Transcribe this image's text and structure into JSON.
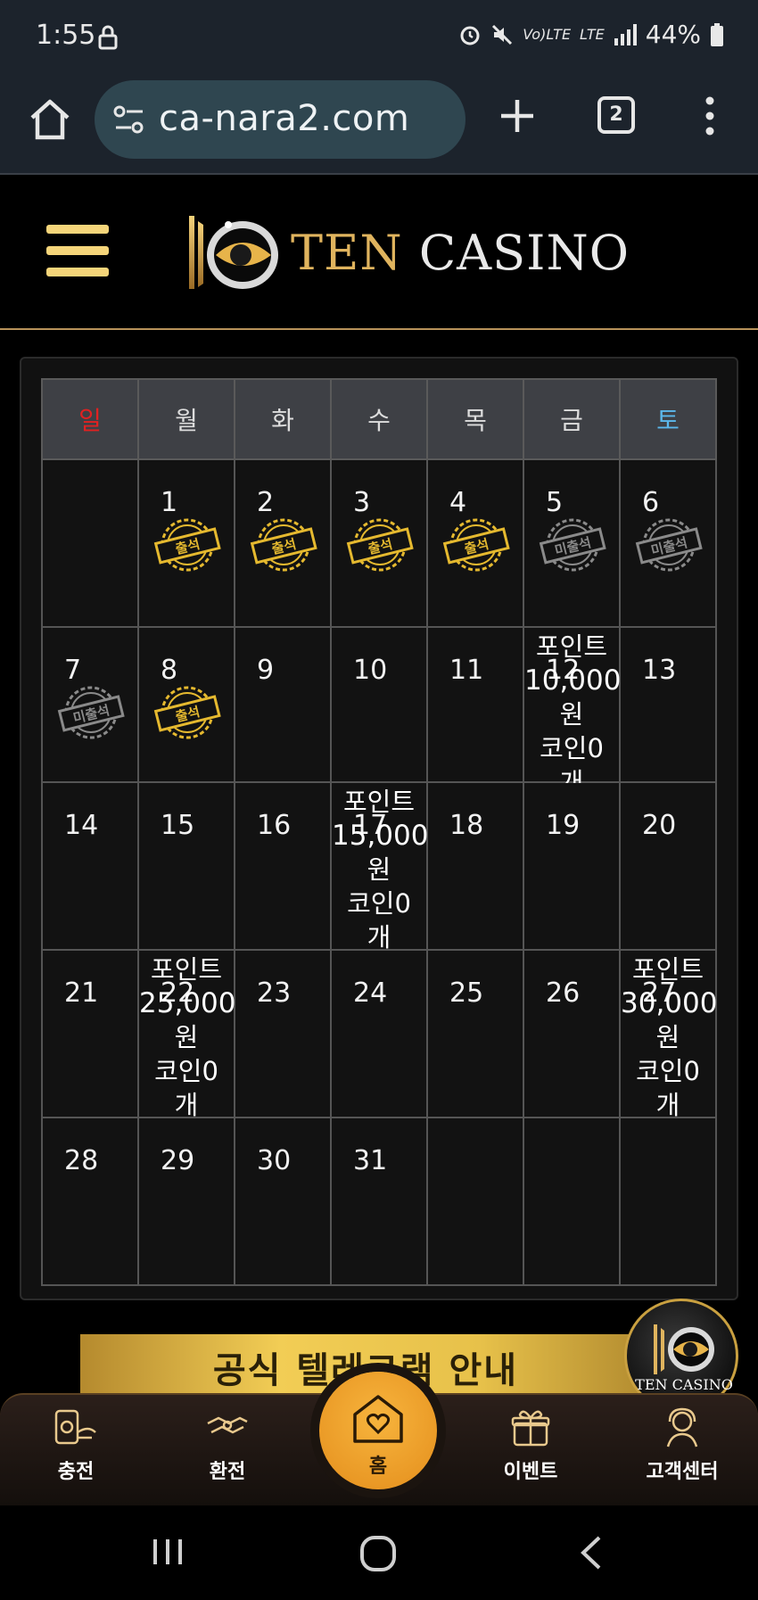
{
  "status_bar": {
    "time": "1:55",
    "network": "Vo)LTE",
    "lte": "LTE",
    "battery": "44%"
  },
  "browser": {
    "url": "ca-nara2.com",
    "tab_count": "2"
  },
  "site": {
    "brand_ten": "TEN",
    "brand_casino": "CASINO"
  },
  "calendar": {
    "weekdays": [
      "일",
      "월",
      "화",
      "수",
      "목",
      "금",
      "토"
    ],
    "weeks": [
      [
        {
          "day": ""
        },
        {
          "day": "1",
          "stamp": "출석"
        },
        {
          "day": "2",
          "stamp": "출석"
        },
        {
          "day": "3",
          "stamp": "출석"
        },
        {
          "day": "4",
          "stamp": "출석"
        },
        {
          "day": "5",
          "stamp": "미출석"
        },
        {
          "day": "6",
          "stamp": "미출석"
        }
      ],
      [
        {
          "day": "7",
          "stamp": "미출석"
        },
        {
          "day": "8",
          "stamp": "출석"
        },
        {
          "day": "9"
        },
        {
          "day": "10"
        },
        {
          "day": "11"
        },
        {
          "day": "12",
          "reward": [
            "포인트",
            "10,000",
            "원",
            "코인0",
            "개"
          ]
        },
        {
          "day": "13"
        }
      ],
      [
        {
          "day": "14"
        },
        {
          "day": "15"
        },
        {
          "day": "16"
        },
        {
          "day": "17",
          "reward": [
            "포인트",
            "15,000",
            "원",
            "코인0",
            "개"
          ]
        },
        {
          "day": "18"
        },
        {
          "day": "19"
        },
        {
          "day": "20"
        }
      ],
      [
        {
          "day": "21"
        },
        {
          "day": "22",
          "reward": [
            "포인트",
            "25,000",
            "원",
            "코인0",
            "개"
          ]
        },
        {
          "day": "23"
        },
        {
          "day": "24"
        },
        {
          "day": "25"
        },
        {
          "day": "26"
        },
        {
          "day": "27",
          "reward": [
            "포인트",
            "30,000",
            "원",
            "코인0",
            "개"
          ]
        }
      ],
      [
        {
          "day": "28"
        },
        {
          "day": "29"
        },
        {
          "day": "30"
        },
        {
          "day": "31"
        },
        {
          "day": ""
        },
        {
          "day": ""
        },
        {
          "day": ""
        }
      ]
    ]
  },
  "banner": {
    "text": "공식 텔레그램 안내",
    "float_logo_text": "TEN CASINO"
  },
  "bottom_nav": {
    "items": [
      "충전",
      "환전",
      "이벤트",
      "고객센터"
    ],
    "home": "홈"
  },
  "colors": {
    "gold": "#e0b45e",
    "stamp_gold": "#e5b92f",
    "stamp_gray": "#8a8a8a",
    "sunday": "#e12121",
    "saturday": "#5bb8ec",
    "home_button": "#f0a22d"
  },
  "icons": {
    "home": "home-icon",
    "site_settings": "site-settings-icon",
    "new_tab": "plus-icon",
    "menu": "more-vert-icon",
    "hamburger": "hamburger-icon",
    "deposit": "deposit-icon",
    "withdraw": "withdraw-icon",
    "event": "gift-icon",
    "support": "support-icon",
    "home_nav": "home-heart-icon"
  }
}
